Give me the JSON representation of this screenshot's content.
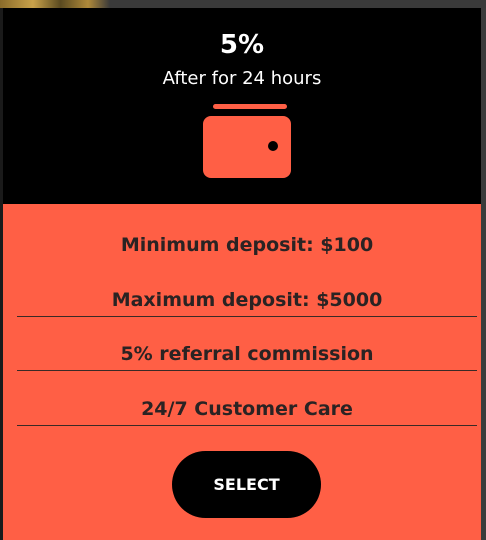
{
  "plan": {
    "rate": "5%",
    "subtitle": "After for 24 hours",
    "icon": "wallet-icon",
    "features": [
      "Minimum deposit: $100",
      "Maximum deposit: $5000",
      "5% referral commission",
      "24/7 Customer Care"
    ],
    "select_label": "SELECT"
  },
  "colors": {
    "accent": "#ff5f45",
    "header_bg": "#000000",
    "text_dark": "#2a2323",
    "button_bg": "#000000",
    "button_text": "#ffffff"
  }
}
